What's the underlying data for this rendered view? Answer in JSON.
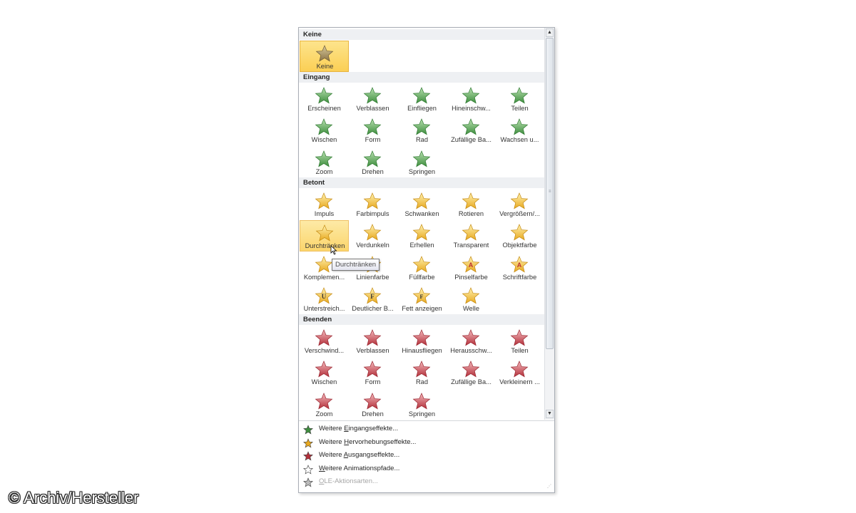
{
  "sections": [
    {
      "title": "Keine",
      "items": [
        {
          "label": "Keine",
          "icon": "star-none-icon",
          "selected": true
        }
      ]
    },
    {
      "title": "Eingang",
      "items": [
        {
          "label": "Erscheinen",
          "icon": "star-appear-icon"
        },
        {
          "label": "Verblassen",
          "icon": "star-fade-icon"
        },
        {
          "label": "Einfliegen",
          "icon": "star-fly-in-icon"
        },
        {
          "label": "Hineinschw...",
          "icon": "star-float-in-icon"
        },
        {
          "label": "Teilen",
          "icon": "star-split-icon"
        },
        {
          "label": "Wischen",
          "icon": "star-wipe-icon"
        },
        {
          "label": "Form",
          "icon": "star-shape-icon"
        },
        {
          "label": "Rad",
          "icon": "star-wheel-icon"
        },
        {
          "label": "Zufällige Ba...",
          "icon": "star-random-bars-icon"
        },
        {
          "label": "Wachsen u...",
          "icon": "star-grow-turn-icon"
        },
        {
          "label": "Zoom",
          "icon": "star-zoom-icon"
        },
        {
          "label": "Drehen",
          "icon": "star-swivel-icon"
        },
        {
          "label": "Springen",
          "icon": "star-bounce-icon"
        }
      ]
    },
    {
      "title": "Betont",
      "items": [
        {
          "label": "Impuls",
          "icon": "star-pulse-icon"
        },
        {
          "label": "Farbimpuls",
          "icon": "star-color-pulse-icon"
        },
        {
          "label": "Schwanken",
          "icon": "star-teeter-icon"
        },
        {
          "label": "Rotieren",
          "icon": "star-spin-icon"
        },
        {
          "label": "Vergrößern/...",
          "icon": "star-grow-shrink-icon"
        },
        {
          "label": "Durchtränken",
          "icon": "star-desaturate-icon",
          "hover": true
        },
        {
          "label": "Verdunkeln",
          "icon": "star-darken-icon"
        },
        {
          "label": "Erhellen",
          "icon": "star-lighten-icon"
        },
        {
          "label": "Transparent",
          "icon": "star-transparency-icon"
        },
        {
          "label": "Objektfarbe",
          "icon": "star-object-color-icon"
        },
        {
          "label": "Komplemen...",
          "icon": "star-complementary-icon"
        },
        {
          "label": "Linienfarbe",
          "icon": "star-line-color-icon"
        },
        {
          "label": "Füllfarbe",
          "icon": "star-fill-color-icon"
        },
        {
          "label": "Pinselfarbe",
          "icon": "star-brush-color-icon"
        },
        {
          "label": "Schriftfarbe",
          "icon": "star-font-color-icon"
        },
        {
          "label": "Unterstreich...",
          "icon": "star-underline-icon"
        },
        {
          "label": "Deutlicher B...",
          "icon": "star-bold-flash-icon"
        },
        {
          "label": "Fett anzeigen",
          "icon": "star-bold-reveal-icon"
        },
        {
          "label": "Welle",
          "icon": "star-wave-icon"
        }
      ]
    },
    {
      "title": "Beenden",
      "items": [
        {
          "label": "Verschwind...",
          "icon": "star-disappear-icon"
        },
        {
          "label": "Verblassen",
          "icon": "star-fade-out-icon"
        },
        {
          "label": "Hinausfliegen",
          "icon": "star-fly-out-icon"
        },
        {
          "label": "Herausschw...",
          "icon": "star-float-out-icon"
        },
        {
          "label": "Teilen",
          "icon": "star-split-out-icon"
        },
        {
          "label": "Wischen",
          "icon": "star-wipe-out-icon"
        },
        {
          "label": "Form",
          "icon": "star-shape-out-icon"
        },
        {
          "label": "Rad",
          "icon": "star-wheel-out-icon"
        },
        {
          "label": "Zufällige Ba...",
          "icon": "star-random-bars-out-icon"
        },
        {
          "label": "Verkleinern ...",
          "icon": "star-shrink-turn-icon"
        },
        {
          "label": "Zoom",
          "icon": "star-zoom-out-icon"
        },
        {
          "label": "Drehen",
          "icon": "star-swivel-out-icon"
        },
        {
          "label": "Springen",
          "icon": "star-bounce-out-icon"
        }
      ]
    }
  ],
  "menu": [
    {
      "pre": "Weitere ",
      "key": "E",
      "post": "ingangseffekte...",
      "icon": "entrance-effects-icon",
      "disabled": false
    },
    {
      "pre": "Weitere ",
      "key": "H",
      "post": "ervorhebungseffekte...",
      "icon": "emphasis-effects-icon",
      "disabled": false
    },
    {
      "pre": "Weitere ",
      "key": "A",
      "post": "usgangseffekte...",
      "icon": "exit-effects-icon",
      "disabled": false
    },
    {
      "pre": "",
      "key": "W",
      "post": "eitere Animationspfade...",
      "icon": "motion-paths-icon",
      "disabled": false
    },
    {
      "pre": "",
      "key": "O",
      "post": "LE-Aktionsarten...",
      "icon": "ole-actions-icon",
      "disabled": true
    }
  ],
  "tooltip": "Durchtränken",
  "watermark": "© Archiv/Hersteller",
  "colors": {
    "entrance": "#5aa55a",
    "emphasis": "#f2c53d",
    "exit": "#c8444c",
    "none": "#a08a5a",
    "selected": "#fbd56c"
  }
}
